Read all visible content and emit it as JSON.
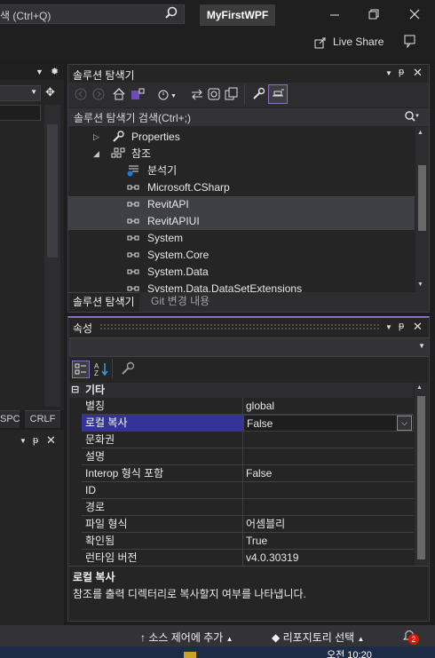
{
  "titlebar": {
    "search_text": "색 (Ctrl+Q)",
    "app_title": "MyFirstWPF",
    "live_share": "Live Share"
  },
  "left": {
    "status_items": [
      "SPC",
      "CRLF"
    ]
  },
  "solution_explorer": {
    "title": "솔루션 탐색기",
    "search_placeholder": "솔루션 탐색기 검색(Ctrl+;)",
    "tree": [
      {
        "label": "Properties",
        "icon": "wrench-icon",
        "expander": "▷"
      },
      {
        "label": "참조",
        "icon": "references-icon",
        "expander": "◢"
      },
      {
        "label": "분석기",
        "icon": "analyzer-icon",
        "expander": ""
      },
      {
        "label": "Microsoft.CSharp",
        "icon": "reference-icon",
        "expander": ""
      },
      {
        "label": "RevitAPI",
        "icon": "reference-icon",
        "expander": "",
        "selected": true
      },
      {
        "label": "RevitAPIUI",
        "icon": "reference-icon",
        "expander": "",
        "selected": true
      },
      {
        "label": "System",
        "icon": "reference-icon",
        "expander": ""
      },
      {
        "label": "System.Core",
        "icon": "reference-icon",
        "expander": ""
      },
      {
        "label": "System.Data",
        "icon": "reference-icon",
        "expander": ""
      },
      {
        "label": "System.Data.DataSetExtensions",
        "icon": "reference-icon",
        "expander": ""
      }
    ],
    "tabs": [
      "솔루션 탐색기",
      "Git 변경 내용"
    ]
  },
  "properties": {
    "title": "속성",
    "category": "기타",
    "rows": [
      {
        "name": "별칭",
        "value": "global"
      },
      {
        "name": "로컬 복사",
        "value": "False",
        "selected": true
      },
      {
        "name": "문화권",
        "value": ""
      },
      {
        "name": "설명",
        "value": ""
      },
      {
        "name": "Interop 형식 포함",
        "value": "False"
      },
      {
        "name": "ID",
        "value": ""
      },
      {
        "name": "경로",
        "value": ""
      },
      {
        "name": "파일 형식",
        "value": "어셈블리"
      },
      {
        "name": "확인됨",
        "value": "True"
      },
      {
        "name": "런타임 버전",
        "value": "v4.0.30319"
      }
    ],
    "description_title": "로컬 복사",
    "description_text": "참조를 출력 디렉터리로 복사할지 여부를 나타냅니다."
  },
  "statusbar": {
    "source_control": "소스 제어에 추가",
    "repository": "리포지토리 선택",
    "notification_count": "2",
    "clock": "오전 10:20"
  },
  "colors": {
    "accent": "#8a6fc8",
    "selection": "#333399",
    "badge": "#e51400"
  }
}
